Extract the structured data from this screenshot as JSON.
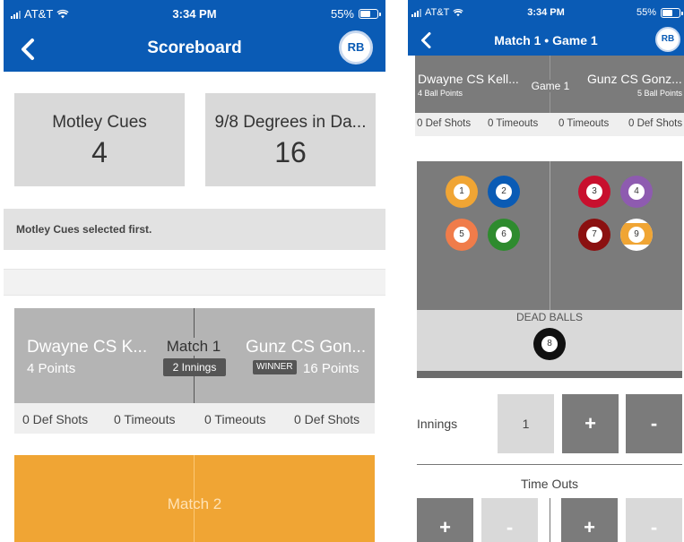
{
  "status_bar": {
    "carrier": "AT&T",
    "time": "3:34 PM",
    "battery": "55%",
    "battery_level": 0.55,
    "icons": [
      "signal-icon",
      "wifi-icon",
      "battery-icon"
    ]
  },
  "colors": {
    "brand_blue": "#0a5bb5",
    "card_gray": "#d9d9d9",
    "match_gray": "#b4b4b4",
    "dark_gray": "#7b7b7b",
    "accent_orange": "#f0a534"
  },
  "left": {
    "header": {
      "title": "Scoreboard",
      "avatar": "RB"
    },
    "teams": [
      {
        "name": "Motley Cues",
        "score": "4"
      },
      {
        "name": "9/8 Degrees in Da...",
        "score": "16"
      }
    ],
    "selected_first": "Motley Cues selected first.",
    "match1": {
      "player_left": "Dwayne CS K...",
      "player_left_points": "4 Points",
      "label": "Match 1",
      "innings": "2 Innings",
      "player_right": "Gunz CS Gon...",
      "winner_badge": "WINNER",
      "player_right_points": "16 Points",
      "stats": [
        "0 Def Shots",
        "0 Timeouts",
        "0 Timeouts",
        "0 Def Shots"
      ]
    },
    "match2": {
      "label": "Match 2"
    }
  },
  "right": {
    "header": {
      "title": "Match 1 • Game 1",
      "avatar": "RB"
    },
    "game": {
      "player_left": "Dwayne CS Kell...",
      "player_left_sub": "4 Ball Points",
      "label": "Game 1",
      "player_right": "Gunz CS Gonz...",
      "player_right_sub": "5 Ball Points",
      "stats": [
        "0 Def Shots",
        "0 Timeouts",
        "0 Timeouts",
        "0 Def Shots"
      ]
    },
    "balls_left": [
      {
        "number": "1",
        "color": "#f0a534",
        "stripe": false
      },
      {
        "number": "2",
        "color": "#0a5bb5",
        "stripe": false
      },
      {
        "number": "5",
        "color": "#f07c4a",
        "stripe": false
      },
      {
        "number": "6",
        "color": "#2e8b2e",
        "stripe": false
      }
    ],
    "balls_right": [
      {
        "number": "3",
        "color": "#c8102e",
        "stripe": false
      },
      {
        "number": "4",
        "color": "#8e5bb0",
        "stripe": false
      },
      {
        "number": "7",
        "color": "#8b1010",
        "stripe": false
      },
      {
        "number": "9",
        "color": "#f0a534",
        "stripe": true
      }
    ],
    "dead_balls": {
      "label": "DEAD BALLS",
      "ball_number": "8",
      "color": "#111111"
    },
    "innings": {
      "label": "Innings",
      "value": "1",
      "plus": "+",
      "minus": "-"
    },
    "timeouts": {
      "label": "Time Outs",
      "plus": "+",
      "minus": "-"
    }
  }
}
